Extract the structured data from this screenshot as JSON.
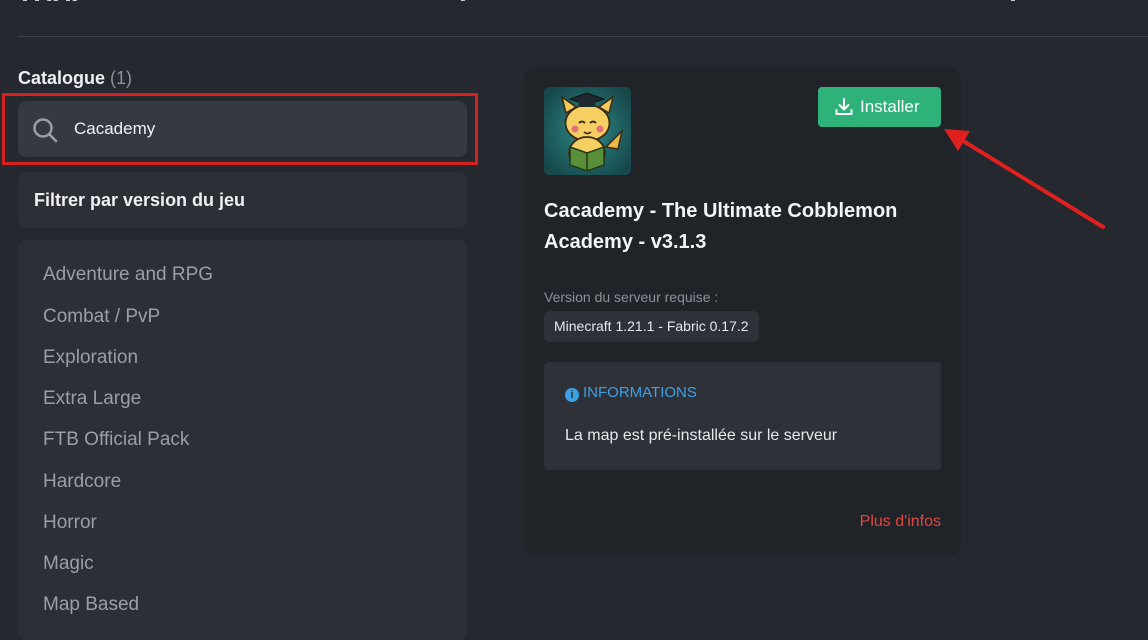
{
  "catalogue": {
    "title": "Catalogue",
    "count": "(1)"
  },
  "search": {
    "value": "Cacademy"
  },
  "filters": {
    "version_label": "Filtrer par version du jeu"
  },
  "categories": [
    "Adventure and RPG",
    "Combat / PvP",
    "Exploration",
    "Extra Large",
    "FTB Official Pack",
    "Hardcore",
    "Horror",
    "Magic",
    "Map Based"
  ],
  "modpack": {
    "title": "Cacademy - The Ultimate Cobblemon Academy - v3.1.3",
    "install_label": "Installer",
    "required_version_label": "Version du serveur requise :",
    "required_version": "Minecraft 1.21.1 - Fabric 0.17.2",
    "info_heading": "INFORMATIONS",
    "info_text": "La map est pré-installée sur le serveur",
    "more_info_label": "Plus d'infos"
  },
  "colors": {
    "background": "#25282e",
    "install_green": "#2fb27a",
    "info_blue": "#3ea0e4",
    "link_red": "#e2463f",
    "highlight_red": "#d4201f"
  },
  "icons": [
    "search-icon",
    "download-icon",
    "info-icon"
  ]
}
